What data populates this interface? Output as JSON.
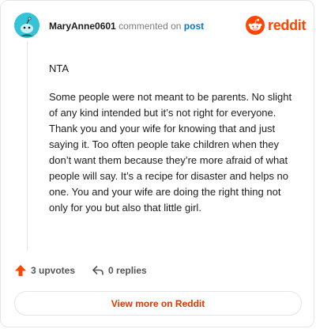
{
  "comment": {
    "username": "MaryAnne0601",
    "action_text": "commented on",
    "post_link": "post",
    "paragraphs": [
      "NTA",
      "Some people were not meant to be parents. No slight of any kind intended but it’s not right for everyone. Thank you and your wife for knowing that and just saying it. Too often people take children when they don’t want them because they’re more afraid of what people will say. It’s a recipe for disaster and helps no one. You and your wife are doing the right thing not only for you but also that little girl."
    ]
  },
  "brand": {
    "name": "reddit",
    "color": "#ff4500"
  },
  "footer": {
    "upvotes": "3 upvotes",
    "replies": "0 replies",
    "view_more": "View more on Reddit"
  },
  "icons": {
    "avatar": "snoo-avatar",
    "brand": "reddit-logo-icon",
    "upvote": "upvote-arrow-icon",
    "reply": "reply-arrow-icon"
  }
}
